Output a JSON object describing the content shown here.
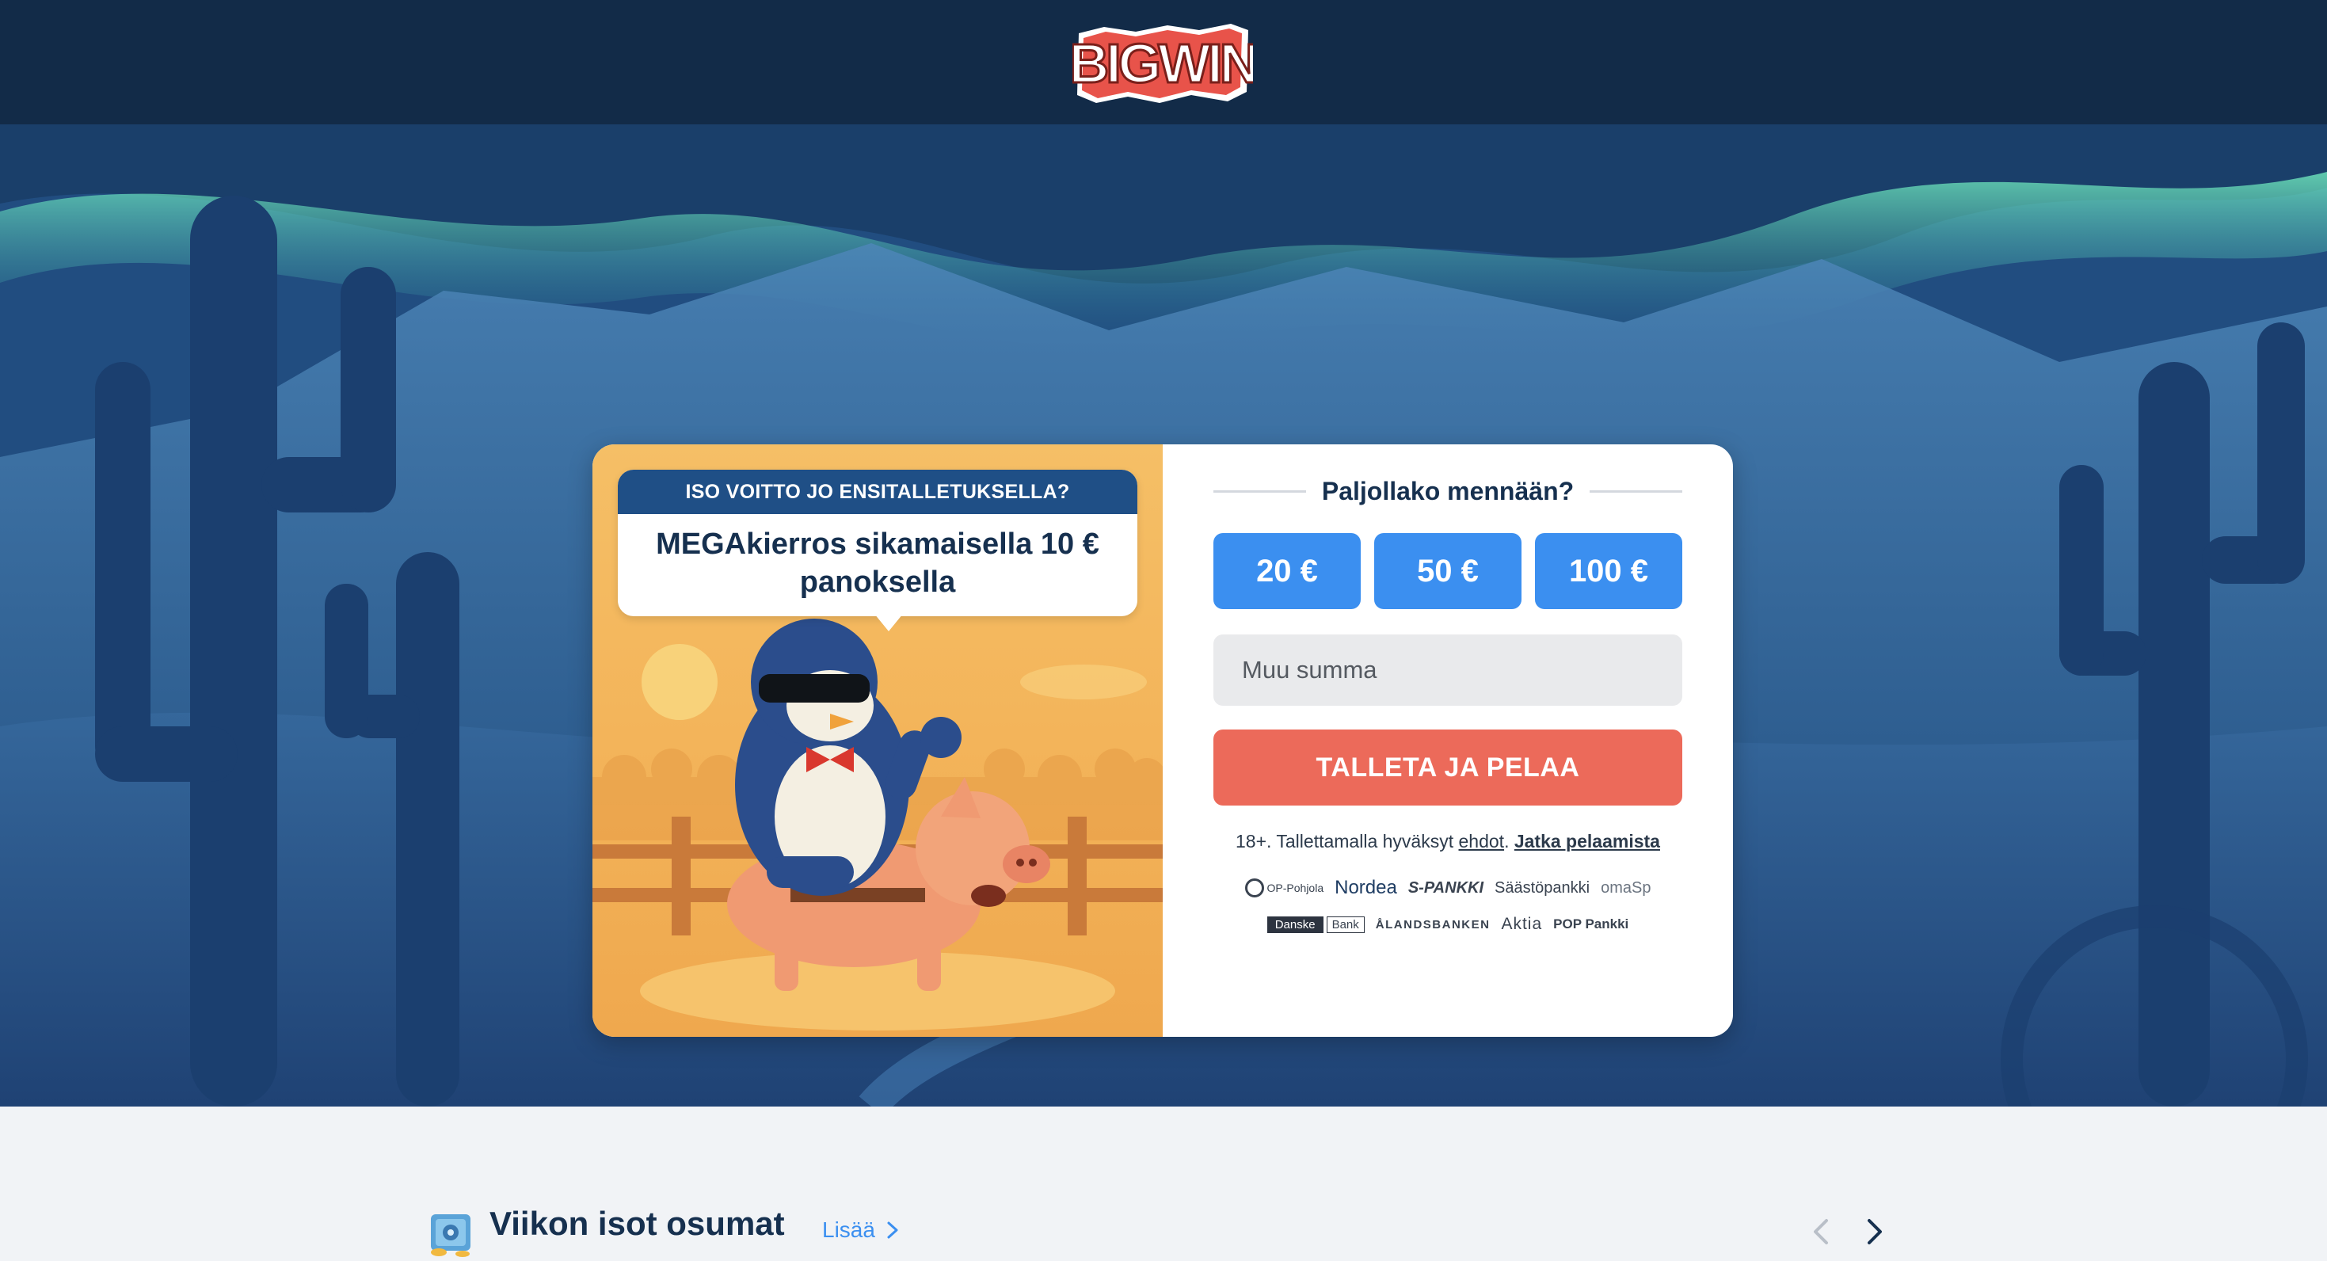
{
  "header": {
    "logo_text": "BIGWIN"
  },
  "promo": {
    "headline": "ISO VOITTO JO ENSITALLETUKSELLA?",
    "offer": "MEGAkierros sikamaisella 10 € panoksella"
  },
  "deposit": {
    "title": "Paljollako mennään?",
    "amounts": [
      "20 €",
      "50 €",
      "100 €"
    ],
    "other_placeholder": "Muu summa",
    "cta_label": "TALLETA JA PELAA",
    "terms_prefix": "18+. Tallettamalla hyväksyt ",
    "terms_link": "ehdot",
    "terms_sep": ". ",
    "continue_link": "Jatka pelaamista"
  },
  "banks": {
    "row1": [
      "OP-Pohjola",
      "Nordea",
      "S-PANKKI",
      "Säästöpankki",
      "omaSp"
    ],
    "danske_a": "Danske",
    "danske_b": "Bank",
    "row2": [
      "ÅLANDSBANKEN",
      "Aktia",
      "POP Pankki"
    ]
  },
  "section": {
    "title": "Viikon isot osumat",
    "more_label": "Lisää"
  },
  "icons": {
    "prev": "chevron-left-icon",
    "next": "chevron-right-icon",
    "vault": "vault-icon"
  },
  "colors": {
    "header_bg": "#122b48",
    "amount_button": "#3b8ff0",
    "cta": "#ec6a5a",
    "text_dark": "#16304f",
    "logo_red": "#e8534a"
  }
}
